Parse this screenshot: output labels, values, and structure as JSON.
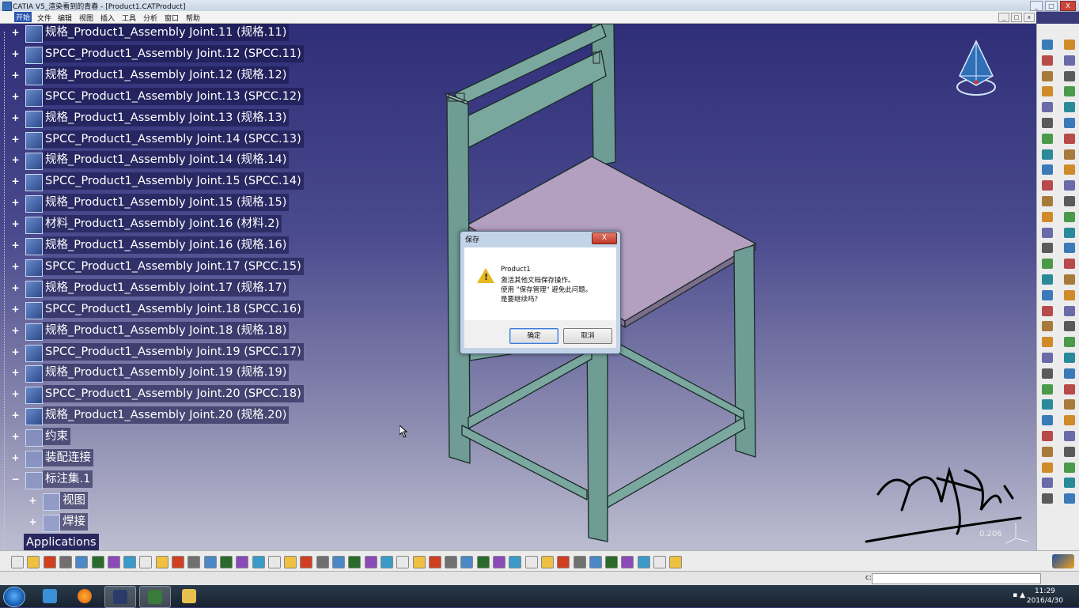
{
  "window": {
    "title": "CATIA V5_渲染看到的青春 - [Product1.CATProduct]",
    "buttons": [
      "_",
      "□",
      "X"
    ]
  },
  "menubar": {
    "items": [
      "开始",
      "文件",
      "编辑",
      "视图",
      "插入",
      "工具",
      "分析",
      "窗口",
      "帮助"
    ]
  },
  "document_buttons": [
    "_",
    "□",
    "x"
  ],
  "tree": {
    "items": [
      {
        "label": "规格_Product1_Assembly Joint.11 (规格.11)"
      },
      {
        "label": "SPCC_Product1_Assembly Joint.12 (SPCC.11)"
      },
      {
        "label": "规格_Product1_Assembly Joint.12 (规格.12)"
      },
      {
        "label": "SPCC_Product1_Assembly Joint.13 (SPCC.12)"
      },
      {
        "label": "规格_Product1_Assembly Joint.13 (规格.13)"
      },
      {
        "label": "SPCC_Product1_Assembly Joint.14 (SPCC.13)"
      },
      {
        "label": "规格_Product1_Assembly Joint.14 (规格.14)"
      },
      {
        "label": "SPCC_Product1_Assembly Joint.15 (SPCC.14)"
      },
      {
        "label": "规格_Product1_Assembly Joint.15 (规格.15)"
      },
      {
        "label": "材料_Product1_Assembly Joint.16 (材料.2)"
      },
      {
        "label": "规格_Product1_Assembly Joint.16 (规格.16)"
      },
      {
        "label": "SPCC_Product1_Assembly Joint.17 (SPCC.15)"
      },
      {
        "label": "规格_Product1_Assembly Joint.17 (规格.17)"
      },
      {
        "label": "SPCC_Product1_Assembly Joint.18 (SPCC.16)"
      },
      {
        "label": "规格_Product1_Assembly Joint.18 (规格.18)"
      },
      {
        "label": "SPCC_Product1_Assembly Joint.19 (SPCC.17)"
      },
      {
        "label": "规格_Product1_Assembly Joint.19 (规格.19)"
      },
      {
        "label": "SPCC_Product1_Assembly Joint.20 (SPCC.18)"
      },
      {
        "label": "规格_Product1_Assembly Joint.20 (规格.20)"
      },
      {
        "label": "约束"
      },
      {
        "label": "装配连接"
      },
      {
        "label": "标注集.1"
      },
      {
        "label": "视图"
      },
      {
        "label": "焊接"
      }
    ],
    "applications": "Applications"
  },
  "dialog": {
    "title": "保存",
    "close": "X",
    "lines": [
      "Product1",
      "激活其他文档保存操作。",
      "使用 \"保存管理\" 避免此问题。",
      "是要继续吗？"
    ],
    "ok": "确定",
    "cancel": "取消"
  },
  "viewport": {
    "scale": "0.206"
  },
  "statusbar": {
    "prompt": "c:"
  },
  "taskbar": {
    "time": "11:29",
    "date": "2016/4/30"
  },
  "colors": {
    "frame": "#6f9c94",
    "frame_dark": "#4d7670",
    "seat": "#b39fc0",
    "background_top": "#2f2e78",
    "background_bottom": "#bdbdd1"
  }
}
